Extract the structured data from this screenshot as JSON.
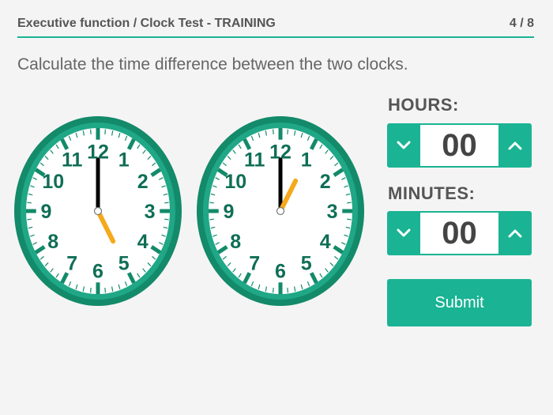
{
  "header": {
    "title": "Executive function / Clock Test - TRAINING",
    "progress": "4 / 8"
  },
  "instruction": "Calculate the time difference between the two clocks.",
  "clocks": [
    {
      "hour": 5,
      "minute": 0,
      "numbers": [
        "12",
        "1",
        "2",
        "3",
        "4",
        "5",
        "6",
        "7",
        "8",
        "9",
        "10",
        "11"
      ]
    },
    {
      "hour": 1,
      "minute": 0,
      "numbers": [
        "12",
        "1",
        "2",
        "3",
        "4",
        "5",
        "6",
        "7",
        "8",
        "9",
        "10",
        "11"
      ]
    }
  ],
  "hours": {
    "label": "HOURS:",
    "value": "00",
    "down_icon": "chevron-down-icon",
    "up_icon": "chevron-up-icon"
  },
  "minutes": {
    "label": "MINUTES:",
    "value": "00",
    "down_icon": "chevron-down-icon",
    "up_icon": "chevron-up-icon"
  },
  "submit_label": "Submit",
  "colors": {
    "accent": "#1ab394",
    "clock_rim": "#138a6a",
    "clock_ring": "#1fa786",
    "clock_number": "#0f6e56",
    "hour_hand": "#f5a91b",
    "minute_hand": "#000000",
    "text": "#555555"
  }
}
